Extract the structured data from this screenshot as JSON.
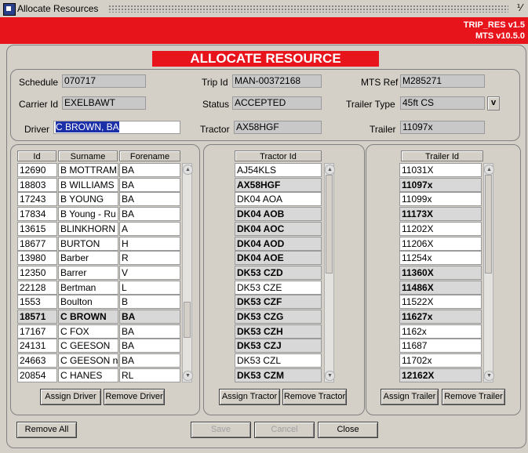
{
  "window": {
    "title": "Allocate Resources",
    "minimize_glyph": "⅟"
  },
  "banner": {
    "app": "TRIP_RES v1.5",
    "system": "MTS v10.5.0"
  },
  "heading": "ALLOCATE RESOURCE",
  "header": {
    "schedule_label": "Schedule",
    "schedule": "070717",
    "trip_label": "Trip Id",
    "trip": "MAN-00372168",
    "mts_ref_label": "MTS Ref",
    "mts_ref": "M285271",
    "carrier_label": "Carrier Id",
    "carrier": "EXELBAWT",
    "status_label": "Status",
    "status": "ACCEPTED",
    "trailer_type_label": "Trailer Type",
    "trailer_type": "45ft CS",
    "lov_label": "v",
    "driver_label": "Driver",
    "driver": "C BROWN, BA",
    "tractor_label": "Tractor",
    "tractor": "AX58HGF",
    "trailer_label": "Trailer",
    "trailer": "11097x"
  },
  "drivers": {
    "col_id": "Id",
    "col_surname": "Surname",
    "col_forename": "Forename",
    "rows": [
      {
        "id": "12690",
        "surname": "B MOTTRAM",
        "forename": "BA"
      },
      {
        "id": "18803",
        "surname": "B WILLIAMS",
        "forename": "BA"
      },
      {
        "id": "17243",
        "surname": "B YOUNG",
        "forename": "BA"
      },
      {
        "id": "17834",
        "surname": "B Young - Ru",
        "forename": "BA"
      },
      {
        "id": "13615",
        "surname": "BLINKHORN",
        "forename": "A"
      },
      {
        "id": "18677",
        "surname": "BURTON",
        "forename": "H"
      },
      {
        "id": "13980",
        "surname": "Barber",
        "forename": "R"
      },
      {
        "id": "12350",
        "surname": "Barrer",
        "forename": "V"
      },
      {
        "id": "22128",
        "surname": "Bertman",
        "forename": "L"
      },
      {
        "id": "1553",
        "surname": "Boulton",
        "forename": "B"
      },
      {
        "id": "18571",
        "surname": "C BROWN",
        "forename": "BA",
        "selected": true
      },
      {
        "id": "17167",
        "surname": "C FOX",
        "forename": "BA"
      },
      {
        "id": "24131",
        "surname": "C GEESON",
        "forename": "BA"
      },
      {
        "id": "24663",
        "surname": "C GEESON ni",
        "forename": "BA"
      },
      {
        "id": "20854",
        "surname": "C HANES",
        "forename": "RL"
      }
    ],
    "assign_label": "Assign Driver",
    "remove_label": "Remove Driver"
  },
  "tractors": {
    "col": "Tractor Id",
    "rows": [
      {
        "v": "AJ54KLS"
      },
      {
        "v": "AX58HGF",
        "b": true
      },
      {
        "v": "DK04 AOA"
      },
      {
        "v": "DK04 AOB",
        "b": true
      },
      {
        "v": "DK04 AOC",
        "b": true
      },
      {
        "v": "DK04 AOD",
        "b": true
      },
      {
        "v": "DK04 AOE",
        "b": true
      },
      {
        "v": "DK53 CZD",
        "b": true
      },
      {
        "v": "DK53 CZE"
      },
      {
        "v": "DK53 CZF",
        "b": true
      },
      {
        "v": "DK53 CZG",
        "b": true
      },
      {
        "v": "DK53 CZH",
        "b": true
      },
      {
        "v": "DK53 CZJ",
        "b": true
      },
      {
        "v": "DK53 CZL"
      },
      {
        "v": "DK53 CZM",
        "b": true
      }
    ],
    "assign_label": "Assign Tractor",
    "remove_label": "Remove Tractor"
  },
  "trailers": {
    "col": "Trailer Id",
    "rows": [
      {
        "v": "11031X"
      },
      {
        "v": "11097x",
        "b": true
      },
      {
        "v": "11099x"
      },
      {
        "v": "11173X",
        "b": true
      },
      {
        "v": "11202X"
      },
      {
        "v": "11206X"
      },
      {
        "v": "11254x"
      },
      {
        "v": "11360X",
        "b": true
      },
      {
        "v": "11486X",
        "b": true
      },
      {
        "v": "11522X"
      },
      {
        "v": "11627x",
        "b": true
      },
      {
        "v": "1162x"
      },
      {
        "v": "11687"
      },
      {
        "v": "11702x"
      },
      {
        "v": "12162X",
        "b": true
      }
    ],
    "assign_label": "Assign Trailer",
    "remove_label": "Remove Trailer"
  },
  "footer": {
    "remove_all": "Remove All",
    "save": "Save",
    "cancel": "Cancel",
    "close": "Close"
  },
  "colors": {
    "banner": "#e8141c",
    "selection": "#1a2fa8"
  }
}
